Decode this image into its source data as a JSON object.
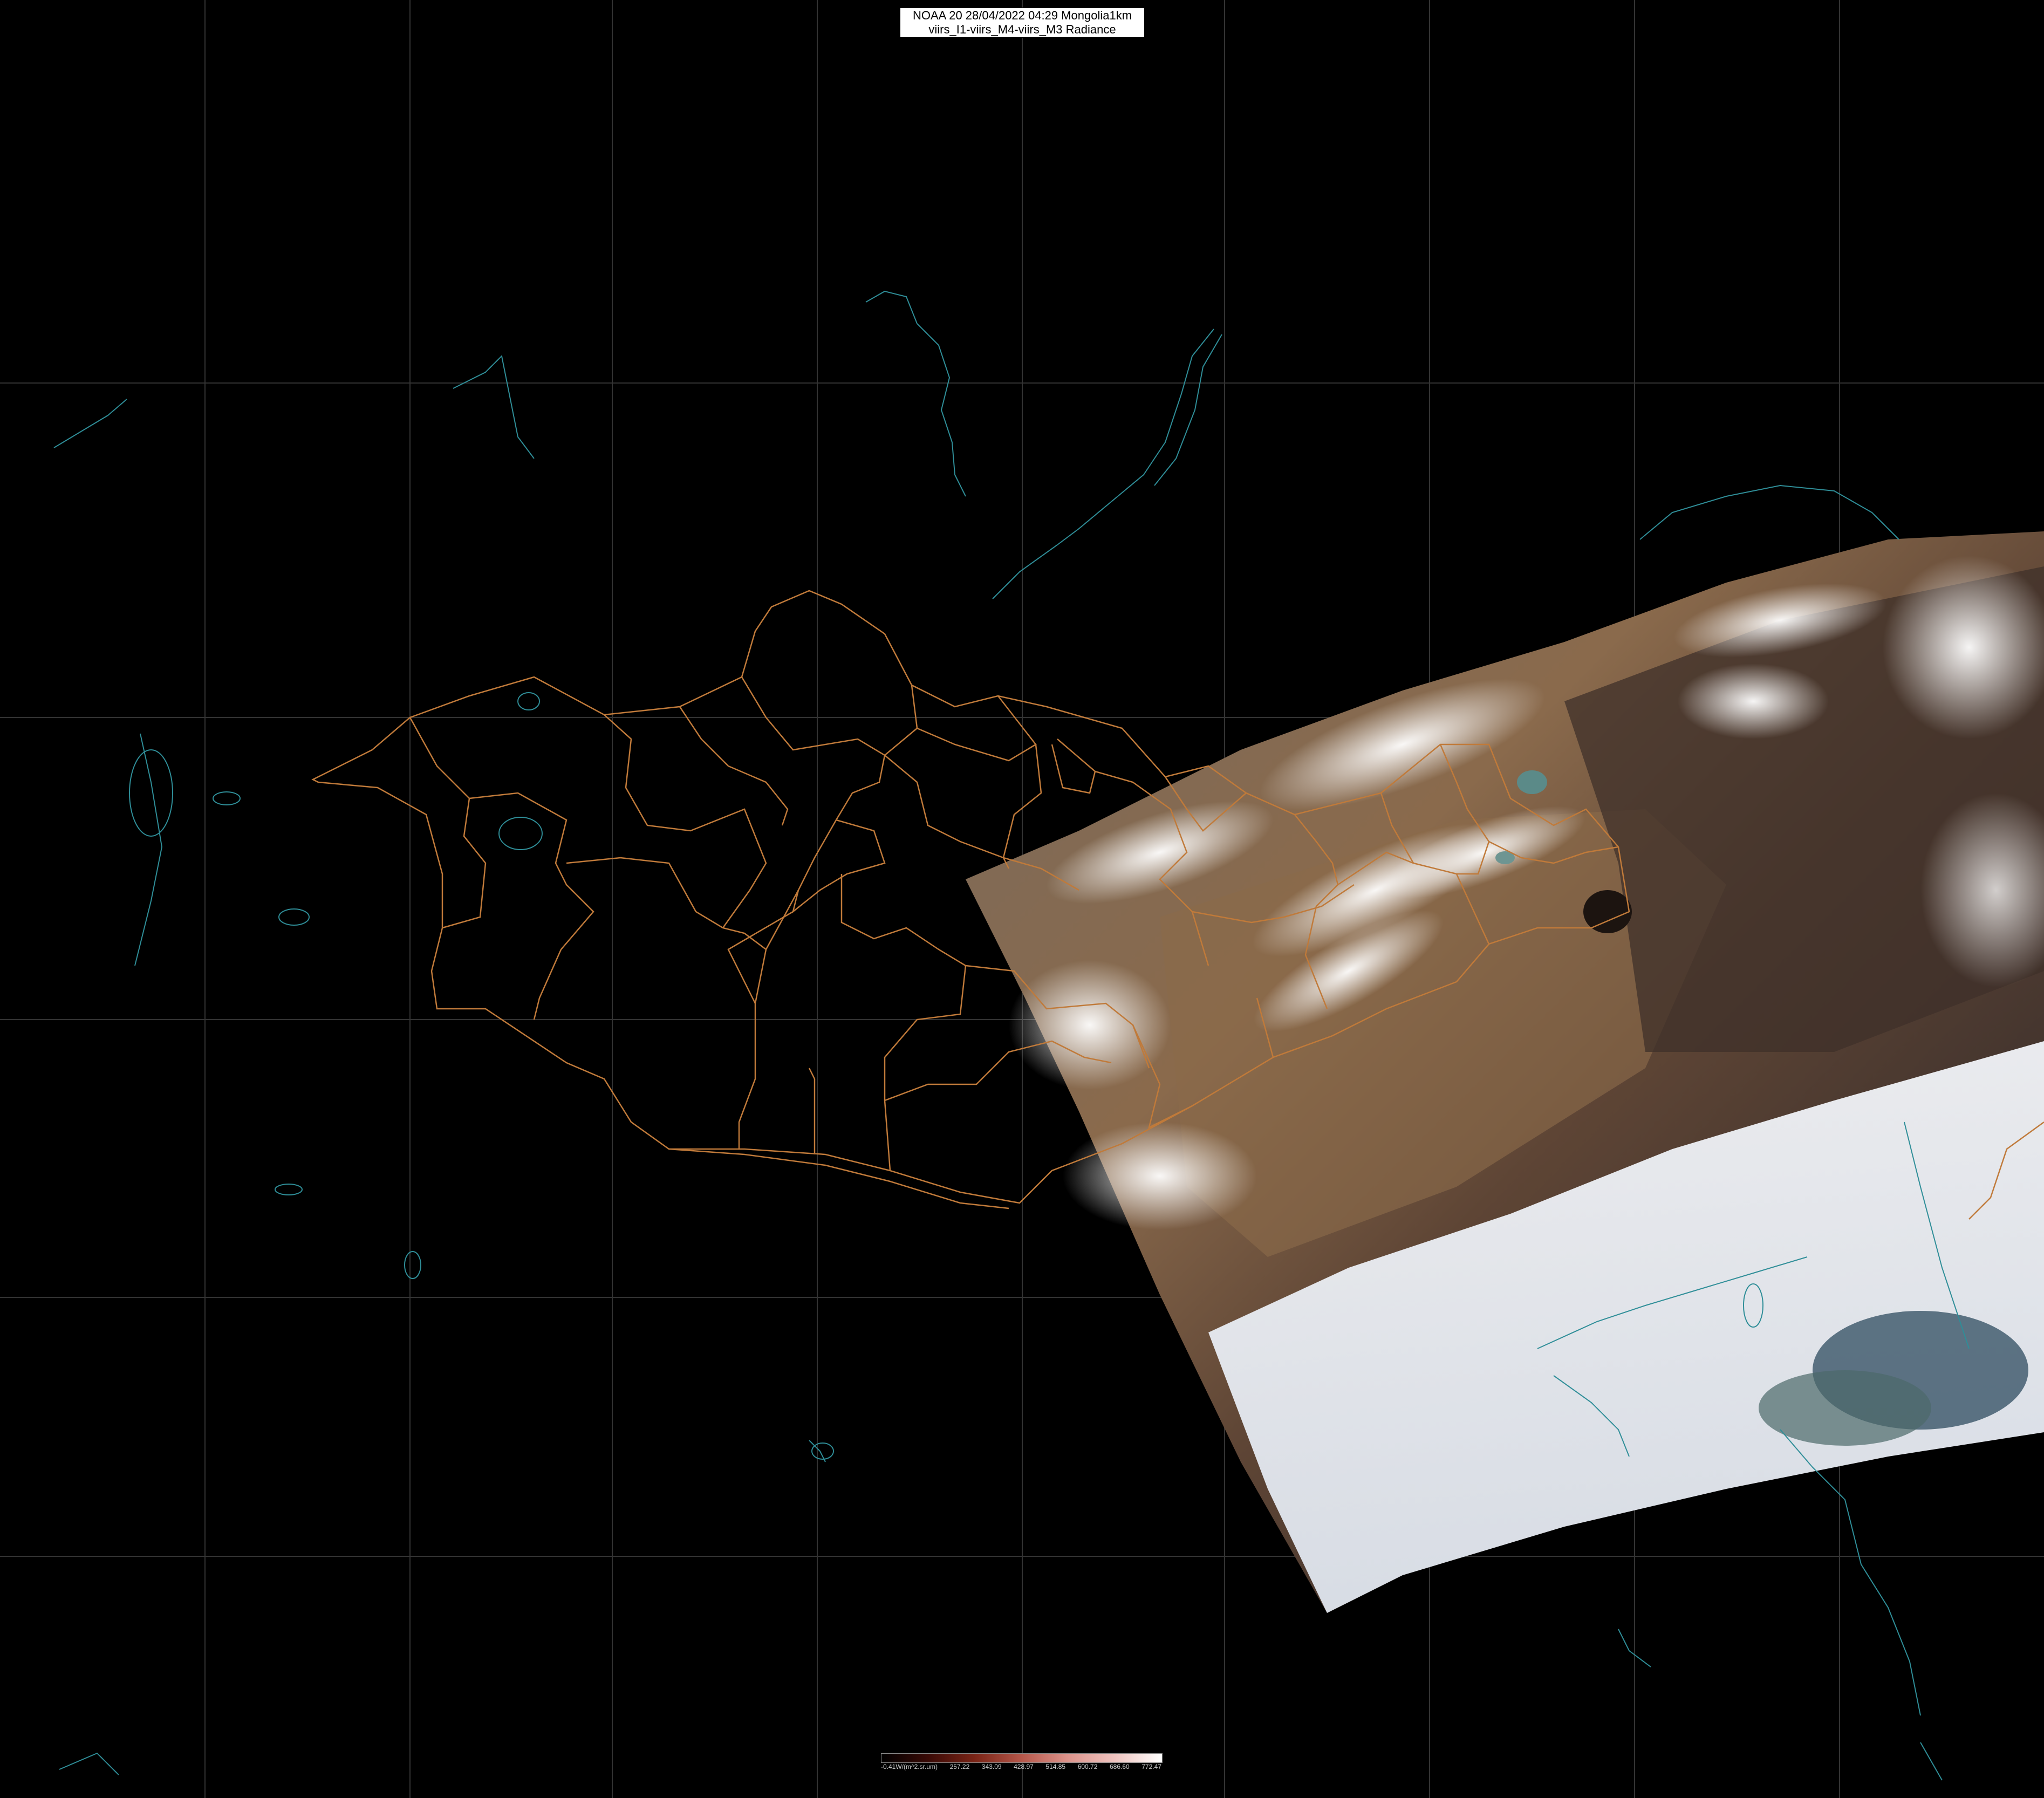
{
  "header": {
    "line1": "NOAA 20 28/04/2022 04:29 Mongolia1km",
    "line2": "viirs_I1-viirs_M4-viirs_M3 Radiance"
  },
  "legend": {
    "unit": "-0.41W/(m^2.sr.um)",
    "ticks": [
      "257.22",
      "343.09",
      "428.97",
      "514.85",
      "600.72",
      "686.60",
      "772.47"
    ],
    "gradient": [
      "#000000",
      "#3a0a06",
      "#7a2416",
      "#b5574a",
      "#dc948c",
      "#efc4c0",
      "#ffffff"
    ]
  },
  "map": {
    "background": "#000000",
    "grid_color": "#333333",
    "border_color": "#c07a3a",
    "coast_color": "#2f8e98",
    "layers": [
      "lat-lon-grid",
      "coastlines-lakes",
      "mongolia-admin-boundaries",
      "satellite-swath"
    ]
  }
}
